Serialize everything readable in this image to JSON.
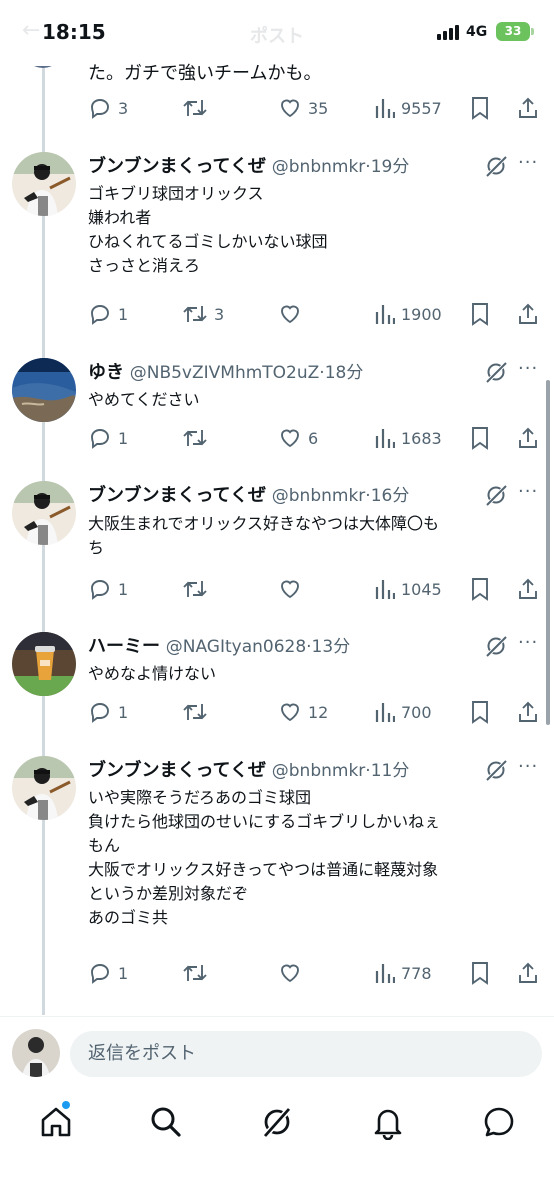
{
  "status_bar": {
    "time": "18:15",
    "network": "4G",
    "battery": "33",
    "ghost_title": "ポスト"
  },
  "top_post": {
    "text": "た。ガチで強いチームかも。",
    "replies": "3",
    "reposts": "",
    "likes": "35",
    "views": "9557"
  },
  "posts": [
    {
      "name": "ブンブンまくってくぜ",
      "handle": "@bnbnmkr",
      "time": "·19分",
      "text": "ゴキブリ球団オリックス\n嫌われ者\nひねくれてるゴミしかいない球団\nさっさと消えろ",
      "replies": "1",
      "reposts": "3",
      "likes": "",
      "views": "1900"
    },
    {
      "name": "ゆき",
      "handle": "@NB5vZIVMhmTO2uZ",
      "time": "·18分",
      "text": "やめてください",
      "replies": "1",
      "reposts": "",
      "likes": "6",
      "views": "1683"
    },
    {
      "name": "ブンブンまくってくぜ",
      "handle": "@bnbnmkr",
      "time": "·16分",
      "text": "大阪生まれでオリックス好きなやつは大体障〇も\nち",
      "replies": "1",
      "reposts": "",
      "likes": "",
      "views": "1045"
    },
    {
      "name": "ハーミー",
      "handle": "@NAGItyan0628",
      "time": "·13分",
      "text": "やめなよ情けない",
      "replies": "1",
      "reposts": "",
      "likes": "12",
      "views": "700"
    },
    {
      "name": "ブンブンまくってくぜ",
      "handle": "@bnbnmkr",
      "time": "·11分",
      "text": "いや実際そうだろあのゴミ球団\n負けたら他球団のせいにするゴキブリしかいねぇ\nもん\n大阪でオリックス好きってやつは普通に軽蔑対象\nというか差別対象だぞ\nあのゴミ共",
      "replies": "1",
      "reposts": "",
      "likes": "",
      "views": "778"
    }
  ],
  "reply_bar": {
    "placeholder": "返信をポスト"
  },
  "icons": {
    "reply": "reply-icon",
    "repost": "repost-icon",
    "like": "heart-icon",
    "views": "views-icon",
    "bookmark": "bookmark-icon",
    "share": "share-icon",
    "grok": "grok-icon",
    "more": "more-icon",
    "tabs": [
      "home-icon",
      "search-icon",
      "grok-icon",
      "bell-icon",
      "message-icon"
    ]
  },
  "colors": {
    "accent": "#1d9bf0",
    "secondary_text": "#536471",
    "battery": "#6cc35d"
  }
}
